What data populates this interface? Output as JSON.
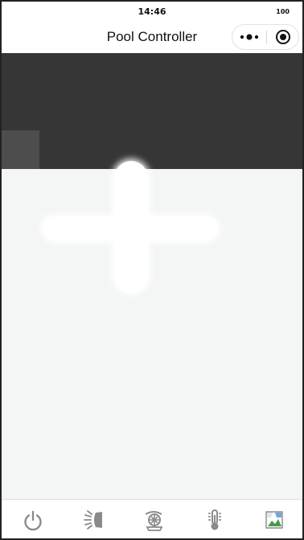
{
  "status_bar": {
    "time": "14:46",
    "battery": "100"
  },
  "nav": {
    "title": "Pool Controller"
  },
  "capsule": {
    "more_icon": "more-dots-icon",
    "close_icon": "target-circle-icon"
  },
  "add_button": {
    "icon": "plus-icon"
  },
  "tab_bar": {
    "tabs": [
      {
        "icon": "power-icon"
      },
      {
        "icon": "light-icon"
      },
      {
        "icon": "pump-fan-icon"
      },
      {
        "icon": "thermometer-icon"
      },
      {
        "icon": "broken-image-icon"
      }
    ]
  },
  "colors": {
    "dark_band": "#363636",
    "side_tab": "#4d4d4d",
    "content_bg": "#f4f6f5",
    "icon_gray": "#8a8a8a"
  }
}
